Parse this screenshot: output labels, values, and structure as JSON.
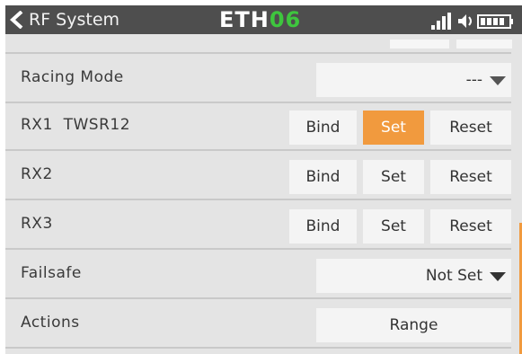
{
  "header": {
    "title": "RF System",
    "logo": {
      "text": "ETH",
      "number": "06"
    }
  },
  "rows": [
    {
      "label": "Racing Mode",
      "value": "---"
    },
    {
      "label": "RX1  TWSR12",
      "bind": "Bind",
      "set": "Set",
      "reset": "Reset",
      "active": "set"
    },
    {
      "label": "RX2",
      "bind": "Bind",
      "set": "Set",
      "reset": "Reset"
    },
    {
      "label": "RX3",
      "bind": "Bind",
      "set": "Set",
      "reset": "Reset"
    },
    {
      "label": "Failsafe",
      "value": "Not Set"
    },
    {
      "label": "Actions",
      "button": "Range"
    }
  ],
  "colors": {
    "accent": "#f19a3e",
    "logo_number": "#3ec63e",
    "titlebar": "#4e4e4e"
  }
}
